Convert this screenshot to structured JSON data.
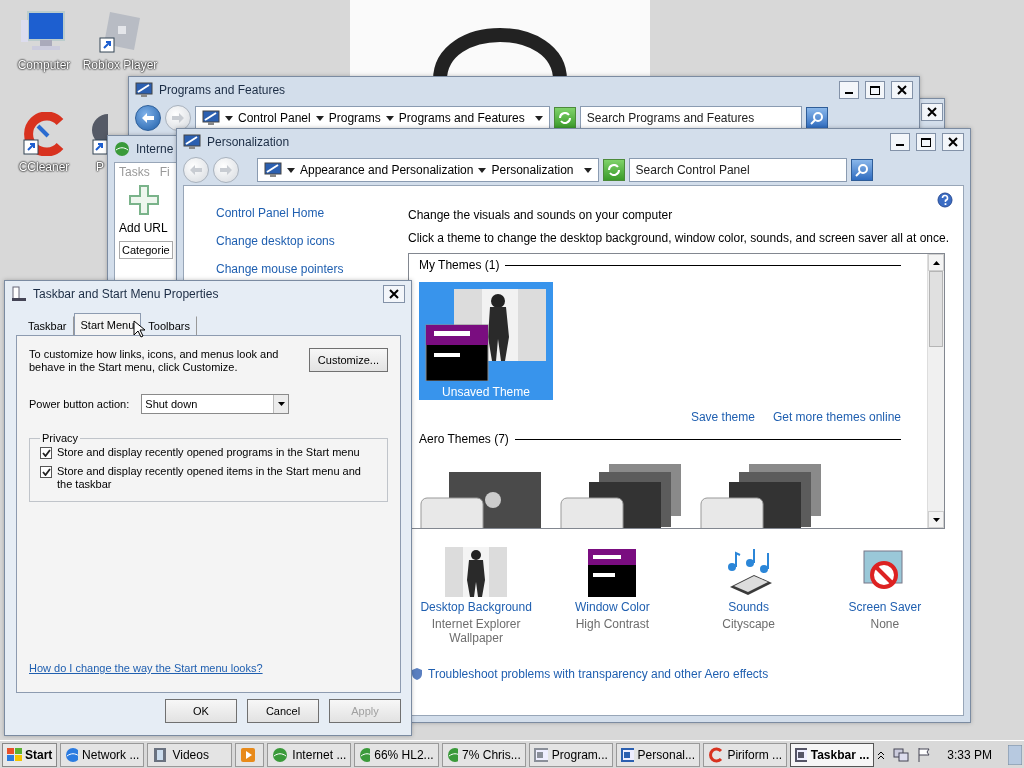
{
  "desktop_icons": [
    {
      "label": "Computer",
      "kind": "computer"
    },
    {
      "label": "Roblox Player",
      "kind": "roblox"
    },
    {
      "label": "CCleaner",
      "kind": "ccleaner"
    },
    {
      "label": "P",
      "kind": "globe"
    }
  ],
  "programs_window": {
    "title": "Programs and Features",
    "breadcrumb": [
      "Control Panel",
      "Programs",
      "Programs and Features"
    ],
    "search": {
      "placeholder": "Search Programs and Features"
    }
  },
  "ie_window": {
    "title": "Interne",
    "menu": [
      "Tasks",
      "Fi"
    ],
    "add_url": "Add URL",
    "categories": "Categorie"
  },
  "personalization": {
    "title": "Personalization",
    "breadcrumb": [
      "Appearance and Personalization",
      "Personalization"
    ],
    "search": {
      "placeholder": "Search Control Panel"
    },
    "sidebar": [
      "Control Panel Home",
      "Change desktop icons",
      "Change mouse pointers"
    ],
    "heading": "Change the visuals and sounds on your computer",
    "subheading": "Click a theme to change the desktop background, window color, sounds, and screen saver all at once.",
    "my_themes": {
      "title": "My Themes (1)",
      "themes": [
        {
          "label": "Unsaved Theme",
          "selected": true
        }
      ]
    },
    "links": [
      "Save theme",
      "Get more themes online"
    ],
    "aero_themes": {
      "title": "Aero Themes (7)"
    },
    "settings": [
      {
        "kind": "background",
        "label": "Desktop Background",
        "value": "Internet Explorer Wallpaper"
      },
      {
        "kind": "color",
        "label": "Window Color",
        "value": "High Contrast"
      },
      {
        "kind": "sounds",
        "label": "Sounds",
        "value": "Cityscape"
      },
      {
        "kind": "screensaver",
        "label": "Screen Saver",
        "value": "None"
      }
    ],
    "troubleshoot": "Troubleshoot problems with transparency and other Aero effects"
  },
  "dialog": {
    "title": "Taskbar and Start Menu Properties",
    "tabs": [
      {
        "label": "Taskbar",
        "selected": false
      },
      {
        "label": "Start Menu",
        "selected": true
      },
      {
        "label": "Toolbars",
        "selected": false
      }
    ],
    "description": "To customize how links, icons, and menus look and behave in the Start menu, click Customize.",
    "customize": "Customize...",
    "power_label": "Power button action:",
    "power_value": "Shut down",
    "privacy": {
      "title": "Privacy",
      "options": [
        {
          "label": "Store and display recently opened programs in the Start menu",
          "checked": true
        },
        {
          "label": "Store and display recently opened items in the Start menu and the taskbar",
          "checked": true
        }
      ]
    },
    "help_link": "How do I change the way the Start menu looks?",
    "buttons": [
      {
        "label": "OK",
        "disabled": false
      },
      {
        "label": "Cancel",
        "disabled": false
      },
      {
        "label": "Apply",
        "disabled": true
      }
    ]
  },
  "taskbar": {
    "start": "Start",
    "items": [
      {
        "label": "Network ...",
        "kind": "ie",
        "selected": false
      },
      {
        "label": "Videos",
        "kind": "film",
        "selected": false
      },
      {
        "kind": "media",
        "selected": false
      },
      {
        "label": "Internet ...",
        "kind": "globe",
        "selected": false
      },
      {
        "label": "66% HL2...",
        "kind": "globe",
        "selected": false
      },
      {
        "label": "7% Chris...",
        "kind": "globe",
        "selected": false
      },
      {
        "label": "Program...",
        "kind": "programs",
        "selected": false
      },
      {
        "label": "Personal...",
        "kind": "personalize",
        "selected": false
      },
      {
        "label": "Piriform ...",
        "kind": "ccleaner",
        "selected": false
      },
      {
        "label": "Taskbar ...",
        "kind": "taskbar",
        "selected": true
      }
    ],
    "clock": "3:33 PM"
  }
}
